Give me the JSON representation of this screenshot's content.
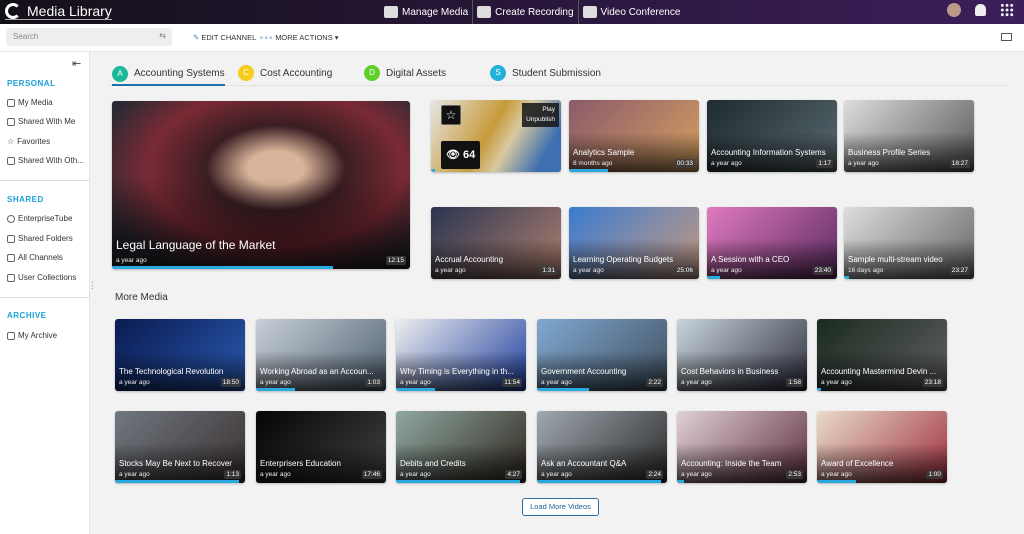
{
  "app": {
    "title": "Media Library"
  },
  "topnav": [
    {
      "label": "Manage Media",
      "icon": "folder-play-icon"
    },
    {
      "label": "Create Recording",
      "icon": "broadcast-icon"
    },
    {
      "label": "Video Conference",
      "icon": "video-conference-icon"
    }
  ],
  "toolbar": {
    "search_placeholder": "Search",
    "edit_channel": "EDIT CHANNEL",
    "more_actions": "MORE ACTIONS"
  },
  "sidebar": {
    "personal": {
      "heading": "PERSONAL",
      "items": [
        "My Media",
        "Shared With Me",
        "Favorites",
        "Shared With Oth..."
      ]
    },
    "shared": {
      "heading": "SHARED",
      "items": [
        "EnterpriseTube",
        "Shared Folders",
        "All Channels",
        "User Collections"
      ]
    },
    "archive": {
      "heading": "ARCHIVE",
      "items": [
        "My Archive"
      ]
    }
  },
  "tabs": [
    {
      "letter": "A",
      "label": "Accounting Systems",
      "color": "#1cb89a",
      "active": true
    },
    {
      "letter": "C",
      "label": "Cost Accounting",
      "color": "#f5cc1a",
      "active": false
    },
    {
      "letter": "D",
      "label": "Digital Assets",
      "color": "#5fcf2a",
      "active": false
    },
    {
      "letter": "S",
      "label": "Student Submission",
      "color": "#22b3dc",
      "active": false
    }
  ],
  "featured": {
    "title": "Legal Language of the Market",
    "age": "a year ago",
    "duration": "12:15",
    "progress": 0.74
  },
  "hover_card": {
    "views": "64",
    "menu": [
      "Play",
      "Unpublish"
    ],
    "progress": 0.03
  },
  "top_cards": [
    {
      "title": "Analytics Sample",
      "age": "8 months ago",
      "duration": "00:33",
      "progress": 0.3
    },
    {
      "title": "Accounting Information Systems",
      "age": "a year ago",
      "duration": "1:17",
      "progress": 0
    },
    {
      "title": "Business Profile Series",
      "age": "a year ago",
      "duration": "18:27",
      "progress": 0
    },
    {
      "title": "Accrual Accounting",
      "age": "a year ago",
      "duration": "1:31",
      "progress": 0
    },
    {
      "title": "Learning Operating Budgets",
      "age": "a year ago",
      "duration": "25:06",
      "progress": 0
    },
    {
      "title": "A Session with a CEO",
      "age": "a year ago",
      "duration": "23:40",
      "progress": 0.1
    },
    {
      "title": "Sample multi-stream video",
      "age": "16 days ago",
      "duration": "23:27",
      "progress": 0.04
    }
  ],
  "more_media": {
    "heading": "More Media",
    "items": [
      {
        "title": "The Technological Revolution",
        "age": "a year ago",
        "duration": "18:50",
        "progress": 0
      },
      {
        "title": "Working Abroad as an Accoun...",
        "age": "a year ago",
        "duration": "1:03",
        "progress": 0.3
      },
      {
        "title": "Why Timing is Everything in th...",
        "age": "a year ago",
        "duration": "11:54",
        "progress": 0.3
      },
      {
        "title": "Government Accounting",
        "age": "a year ago",
        "duration": "2:22",
        "progress": 0.4
      },
      {
        "title": "Cost Behaviors in Business",
        "age": "a year ago",
        "duration": "1:58",
        "progress": 0
      },
      {
        "title": "Accounting Mastermind Devin ...",
        "age": "a year ago",
        "duration": "23:18",
        "progress": 0.03
      },
      {
        "title": "Stocks May Be Next to Recover",
        "age": "a year ago",
        "duration": "1:13",
        "progress": 0.95
      },
      {
        "title": "Enterprisers Education",
        "age": "a year ago",
        "duration": "17:46",
        "progress": 0
      },
      {
        "title": "Debits and Credits",
        "age": "a year ago",
        "duration": "4:27",
        "progress": 0.95
      },
      {
        "title": "Ask an Accountant Q&A",
        "age": "a year ago",
        "duration": "2:24",
        "progress": 0.95
      },
      {
        "title": "Accounting: Inside the Team",
        "age": "a year ago",
        "duration": "2:53",
        "progress": 0.05
      },
      {
        "title": "Award of Excellence",
        "age": "a year ago",
        "duration": "1:00",
        "progress": 0.3
      }
    ]
  },
  "load_more": "Load More Videos"
}
